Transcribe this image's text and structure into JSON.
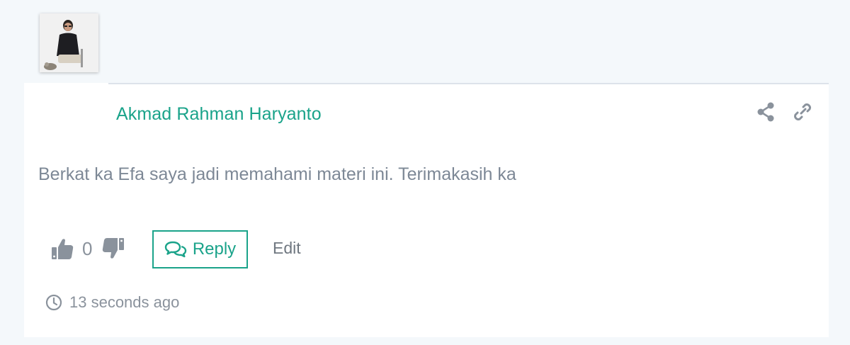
{
  "comment": {
    "author_name": "Akmad Rahman Haryanto",
    "text": "Berkat ka Efa saya jadi memahami materi ini. Terimakasih ka",
    "vote_count": "0",
    "reply_label": "Reply",
    "edit_label": "Edit",
    "timestamp": "13 seconds ago"
  },
  "icons": {
    "share": "share-icon",
    "link": "link-icon",
    "upvote": "thumbs-up-icon",
    "downvote": "thumbs-down-icon",
    "reply": "comments-icon",
    "time": "clock-icon"
  },
  "colors": {
    "accent": "#1aa38a",
    "text_muted": "#7d8896",
    "icon_gray": "#8a929c",
    "background": "#f4f8fb"
  }
}
